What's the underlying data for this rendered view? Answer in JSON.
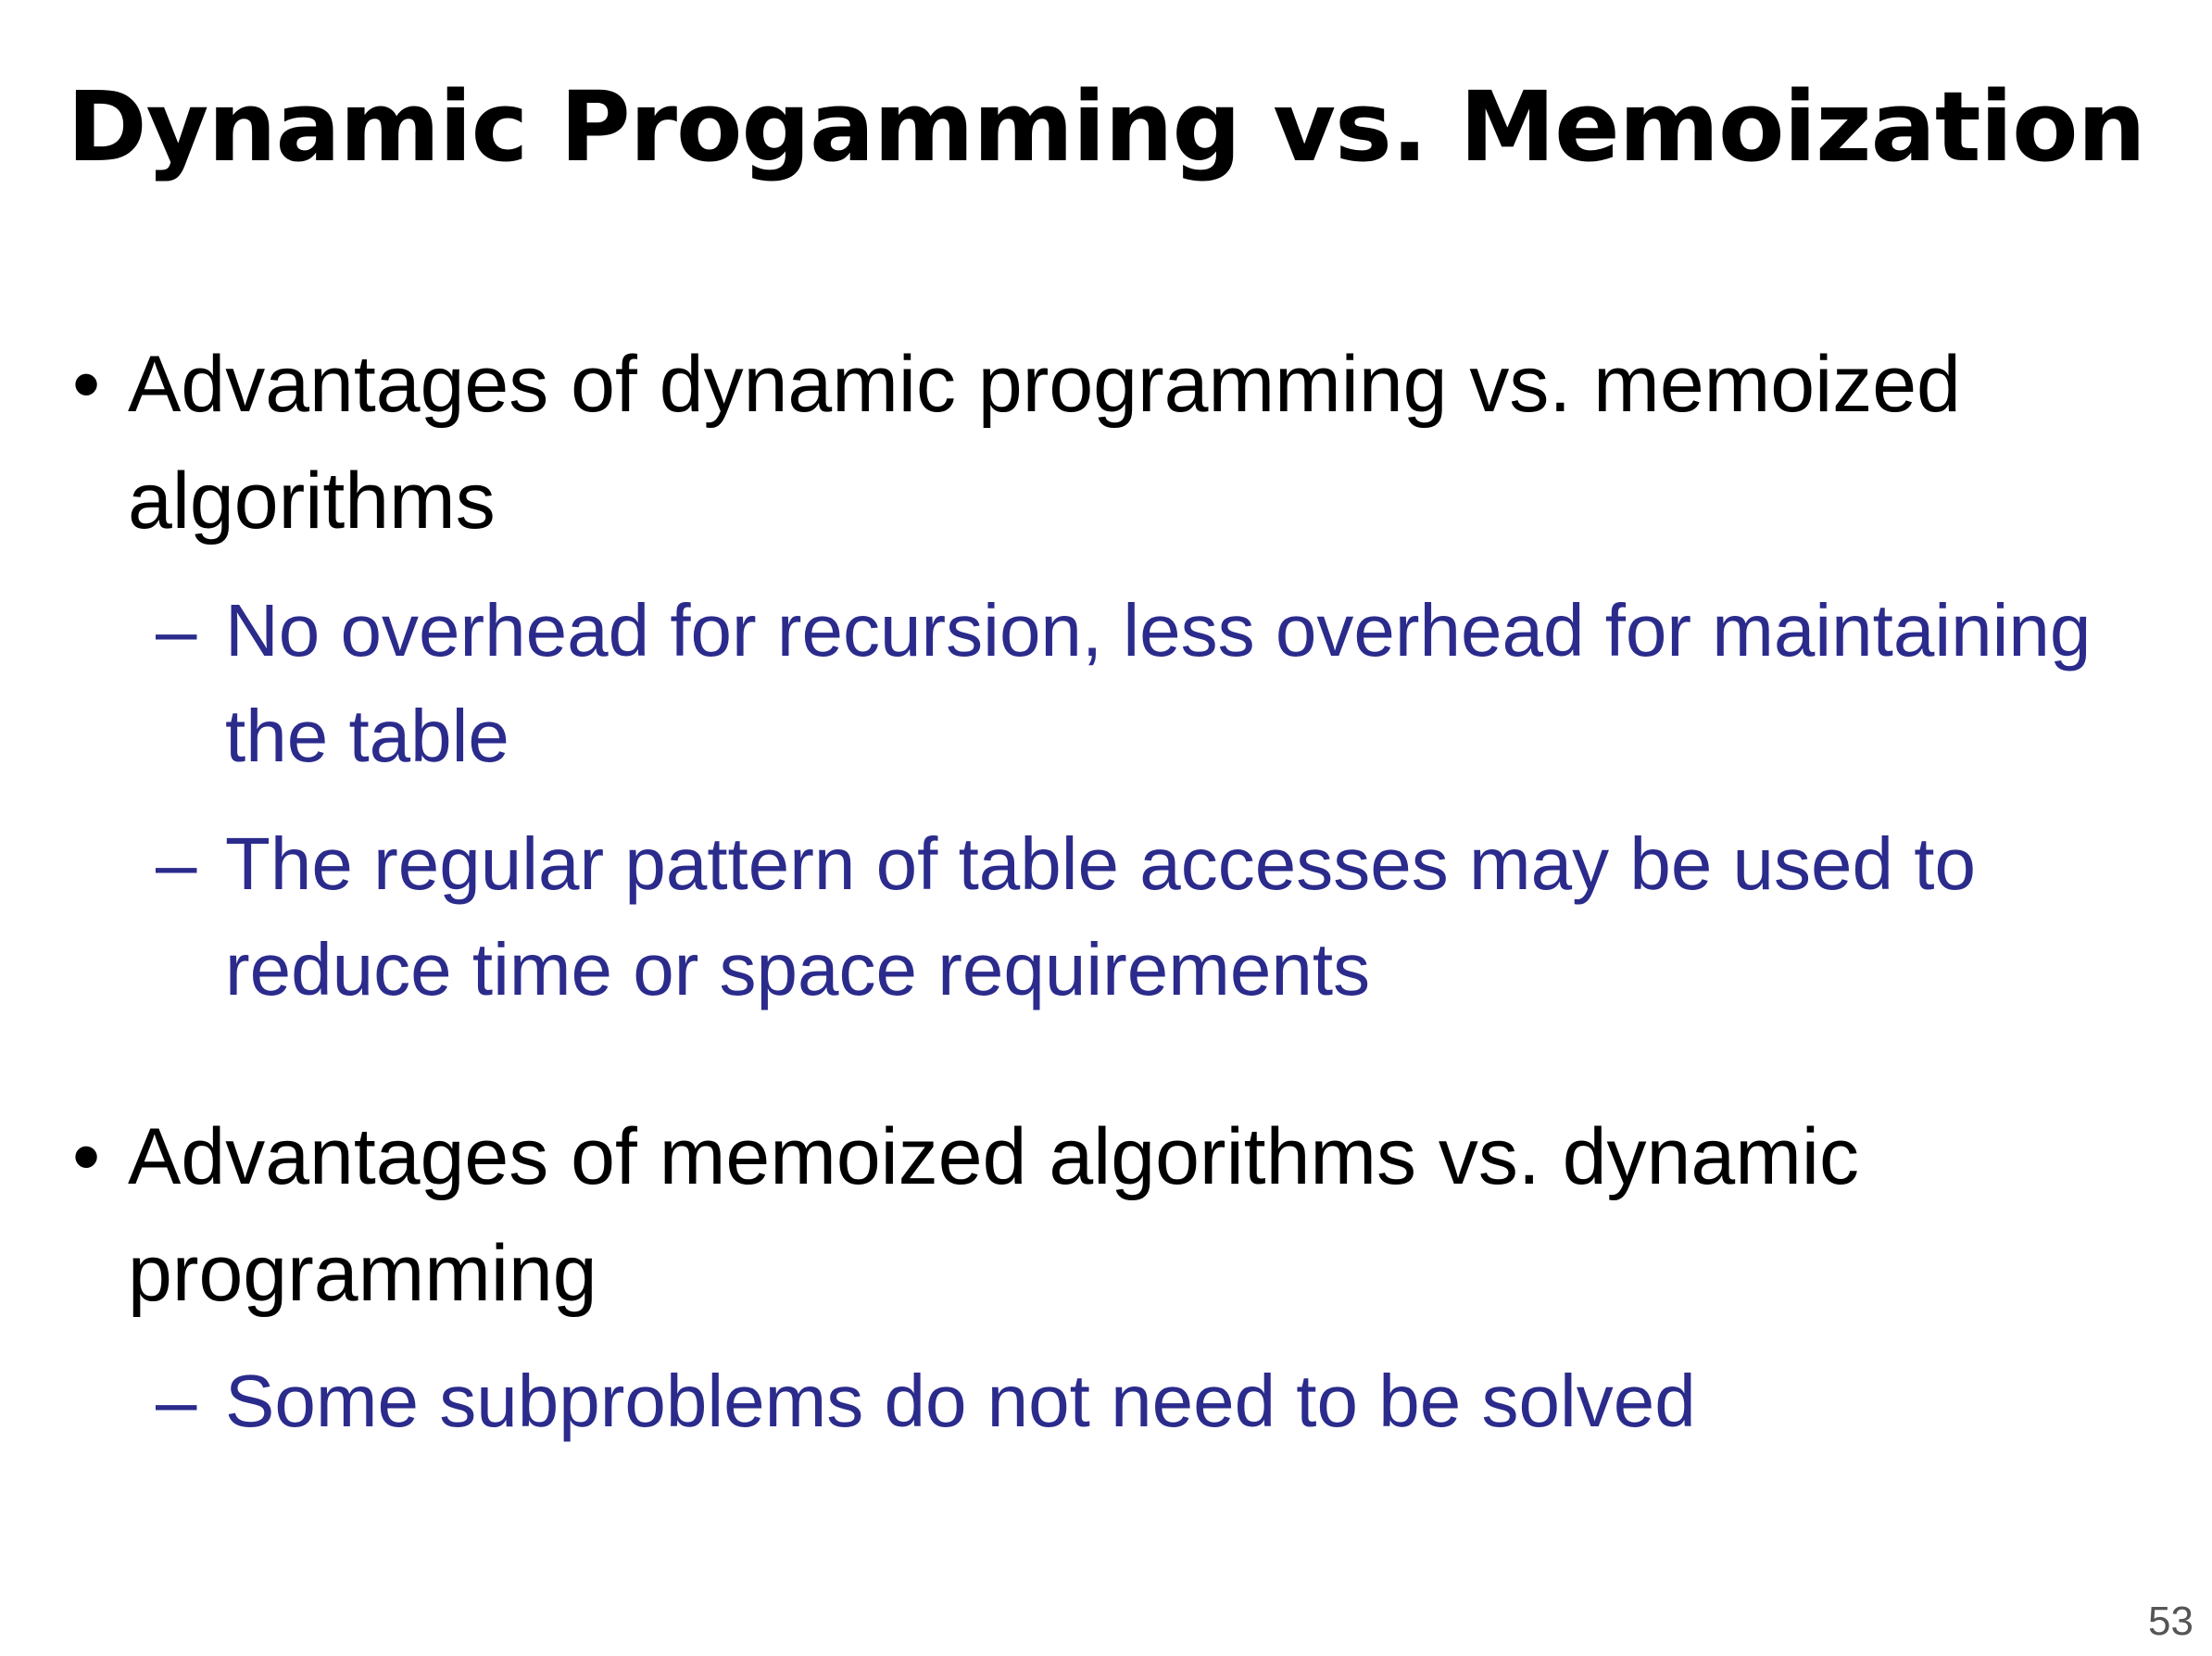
{
  "slide": {
    "title": "Dynamic Progamming vs. Memoization",
    "bullets": [
      {
        "marker": "•",
        "text": "Advantages of dynamic programming vs. memoized algorithms",
        "subitems": [
          {
            "marker": "–",
            "text": "No overhead for recursion, less overhead for maintaining the table"
          },
          {
            "marker": "–",
            "text": "The regular pattern of table accesses may be used to reduce time or space requirements"
          }
        ]
      },
      {
        "marker": "•",
        "text": "Advantages of memoized algorithms vs. dynamic programming",
        "subitems": [
          {
            "marker": "–",
            "text": "Some subproblems do not need to be solved"
          }
        ]
      }
    ],
    "page_number": "53"
  },
  "colors": {
    "title": "#000000",
    "bullet_text": "#000000",
    "subitem_text": "#2b2b8c",
    "background": "#ffffff"
  }
}
